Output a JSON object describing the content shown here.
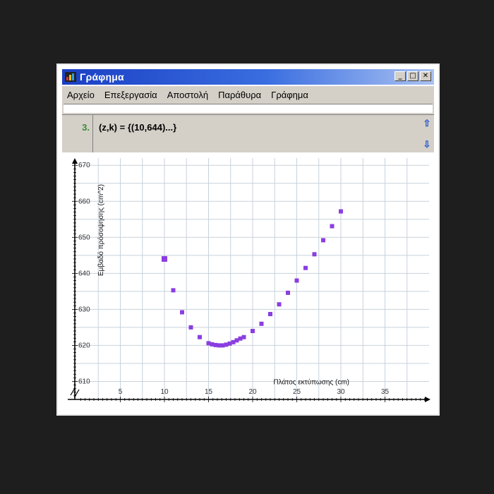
{
  "window": {
    "title": "Γράφημα",
    "buttons": {
      "minimize": "_",
      "maximize": "□",
      "close": "✕"
    }
  },
  "menu": [
    "Αρχείο",
    "Επεξεργασία",
    "Αποστολή",
    "Παράθυρα",
    "Γράφημα"
  ],
  "command": {
    "number": "3.",
    "text": "(z,k) = {(10,644)...}"
  },
  "scroll": {
    "up_icon": "arrow-up-icon",
    "down_icon": "arrow-down-icon"
  },
  "colors": {
    "points": "#8a3ee0",
    "grid": "#c8d2dc",
    "title_bar": "#1a3fc4"
  },
  "chart_data": {
    "type": "scatter",
    "xlabel": "Πλάτος εκτύπωσης (cm)",
    "ylabel": "Εμβαδό πρόσοψησης (cm^2)",
    "xlim": [
      0,
      40
    ],
    "ylim": [
      605,
      672
    ],
    "x_ticks": [
      5,
      10,
      15,
      20,
      25,
      30,
      35
    ],
    "y_ticks": [
      610,
      620,
      630,
      640,
      650,
      660,
      670
    ],
    "grid": true,
    "points": [
      {
        "x": 10,
        "y": 644
      },
      {
        "x": 11,
        "y": 635.3
      },
      {
        "x": 12,
        "y": 629.2
      },
      {
        "x": 13,
        "y": 625
      },
      {
        "x": 14,
        "y": 622.3
      },
      {
        "x": 15,
        "y": 620.6
      },
      {
        "x": 15.4,
        "y": 620.3
      },
      {
        "x": 15.8,
        "y": 620.1
      },
      {
        "x": 16.2,
        "y": 620
      },
      {
        "x": 16.6,
        "y": 620
      },
      {
        "x": 17,
        "y": 620.2
      },
      {
        "x": 17.4,
        "y": 620.5
      },
      {
        "x": 17.8,
        "y": 620.9
      },
      {
        "x": 18.2,
        "y": 621.4
      },
      {
        "x": 18.6,
        "y": 621.9
      },
      {
        "x": 19,
        "y": 622.3
      },
      {
        "x": 20,
        "y": 624
      },
      {
        "x": 21,
        "y": 626
      },
      {
        "x": 22,
        "y": 628.7
      },
      {
        "x": 23,
        "y": 631.4
      },
      {
        "x": 24,
        "y": 634.6
      },
      {
        "x": 25,
        "y": 638
      },
      {
        "x": 26,
        "y": 641.5
      },
      {
        "x": 27,
        "y": 645.3
      },
      {
        "x": 28,
        "y": 649.2
      },
      {
        "x": 29,
        "y": 653.1
      },
      {
        "x": 30,
        "y": 657.2
      }
    ]
  }
}
